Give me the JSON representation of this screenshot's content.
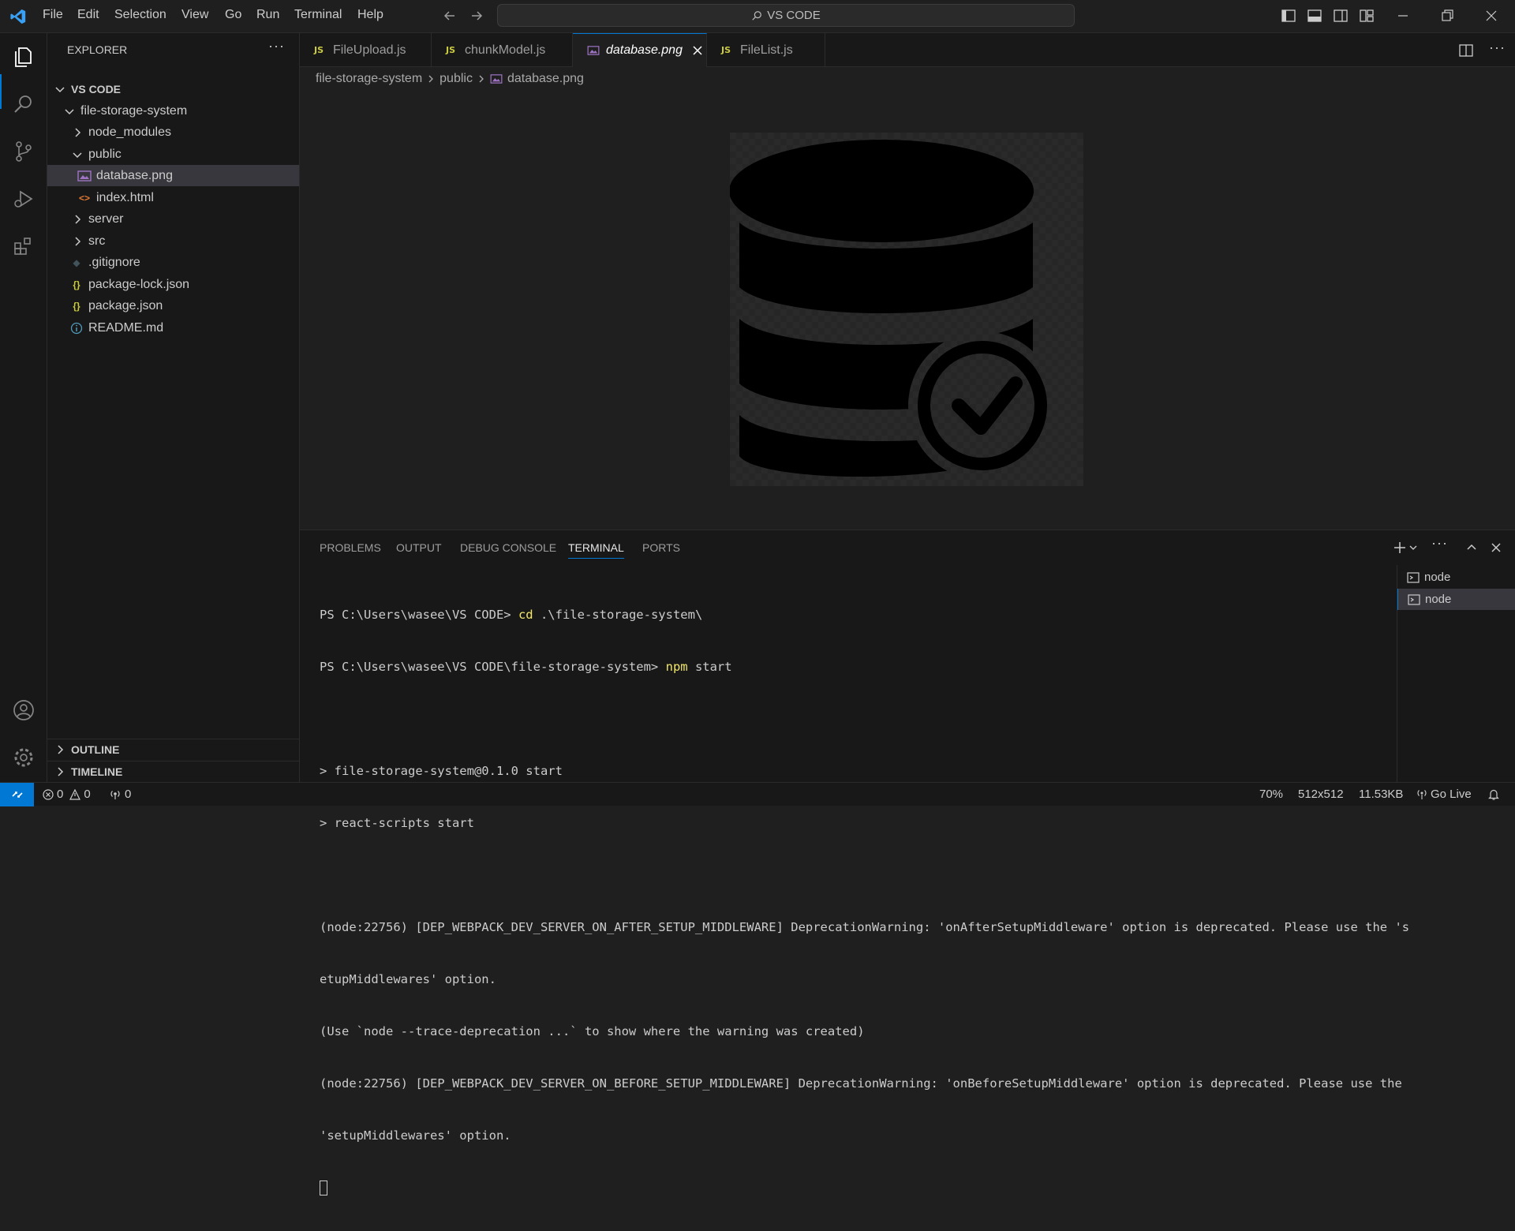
{
  "menu": [
    "File",
    "Edit",
    "Selection",
    "View",
    "Go",
    "Run",
    "Terminal",
    "Help"
  ],
  "search": {
    "text": "VS CODE"
  },
  "sidebar": {
    "title": "EXPLORER",
    "root": "VS CODE",
    "project": "file-storage-system",
    "items": [
      {
        "label": "node_modules",
        "type": "folder"
      },
      {
        "label": "public",
        "type": "folder-open"
      },
      {
        "label": "database.png",
        "type": "image"
      },
      {
        "label": "index.html",
        "type": "html"
      },
      {
        "label": "server",
        "type": "folder"
      },
      {
        "label": "src",
        "type": "folder"
      },
      {
        "label": ".gitignore",
        "type": "git"
      },
      {
        "label": "package-lock.json",
        "type": "json"
      },
      {
        "label": "package.json",
        "type": "json"
      },
      {
        "label": "README.md",
        "type": "info"
      }
    ],
    "outline": "OUTLINE",
    "timeline": "TIMELINE"
  },
  "tabs": [
    {
      "label": "FileUpload.js",
      "badge": "JS"
    },
    {
      "label": "chunkModel.js",
      "badge": "JS"
    },
    {
      "label": "database.png",
      "badge": ""
    },
    {
      "label": "FileList.js",
      "badge": "JS"
    }
  ],
  "breadcrumb": [
    "file-storage-system",
    "public",
    "database.png"
  ],
  "panel": {
    "tabs": [
      "PROBLEMS",
      "OUTPUT",
      "DEBUG CONSOLE",
      "TERMINAL",
      "PORTS"
    ],
    "terminal_lines": [
      {
        "prefix": "PS C:\\Users\\wasee\\VS CODE> ",
        "cmd": "cd",
        "rest": " .\\file-storage-system\\"
      },
      {
        "prefix": "PS C:\\Users\\wasee\\VS CODE\\file-storage-system> ",
        "cmd": "npm",
        "rest": " start"
      },
      {
        "prefix": "",
        "cmd": "",
        "rest": ""
      },
      {
        "prefix": "> file-storage-system@0.1.0 start",
        "cmd": "",
        "rest": ""
      },
      {
        "prefix": "> react-scripts start",
        "cmd": "",
        "rest": ""
      },
      {
        "prefix": "",
        "cmd": "",
        "rest": ""
      },
      {
        "prefix": "(node:22756) [DEP_WEBPACK_DEV_SERVER_ON_AFTER_SETUP_MIDDLEWARE] DeprecationWarning: 'onAfterSetupMiddleware' option is deprecated. Please use the 's",
        "cmd": "",
        "rest": ""
      },
      {
        "prefix": "etupMiddlewares' option.",
        "cmd": "",
        "rest": ""
      },
      {
        "prefix": "(Use `node --trace-deprecation ...` to show where the warning was created)",
        "cmd": "",
        "rest": ""
      },
      {
        "prefix": "(node:22756) [DEP_WEBPACK_DEV_SERVER_ON_BEFORE_SETUP_MIDDLEWARE] DeprecationWarning: 'onBeforeSetupMiddleware' option is deprecated. Please use the",
        "cmd": "",
        "rest": ""
      },
      {
        "prefix": "'setupMiddlewares' option.",
        "cmd": "",
        "rest": ""
      }
    ],
    "terminals": [
      "node",
      "node"
    ]
  },
  "status": {
    "errors": "0",
    "warnings": "0",
    "ports": "0",
    "zoom": "70%",
    "dimensions": "512x512",
    "size": "11.53KB",
    "golive": "Go Live"
  },
  "colors": {
    "accent": "#0078d4",
    "bg": "#1f1f1f",
    "sidebar": "#181818"
  }
}
